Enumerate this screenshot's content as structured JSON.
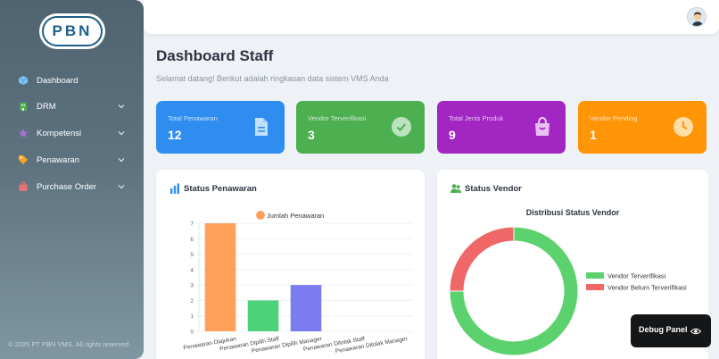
{
  "sidebar": {
    "logo": "PBN",
    "items": [
      {
        "label": "Dashboard",
        "icon": "cube-icon",
        "color": "#7cc4f0"
      },
      {
        "label": "DRM",
        "icon": "building-icon",
        "color": "#4caf50"
      },
      {
        "label": "Kompetensi",
        "icon": "star-icon",
        "color": "#b06bd6"
      },
      {
        "label": "Penawaran",
        "icon": "tag-icon",
        "color": "#f5a623"
      },
      {
        "label": "Purchase Order",
        "icon": "cart-icon",
        "color": "#e57373"
      }
    ],
    "copyright": "© 2025 PT PBN VMS. All rights reserved."
  },
  "header": {
    "title": "Dashboard Staff",
    "subtitle": "Selamat datang! Berikut adalah ringkasan data sistem VMS Anda"
  },
  "stats": [
    {
      "label": "Total Penawaran",
      "value": "12",
      "color": "#2f8df0",
      "icon": "document-icon"
    },
    {
      "label": "Vendor Terverifikasi",
      "value": "3",
      "color": "#4caf50",
      "icon": "check-circle-icon"
    },
    {
      "label": "Total Jenis Produk",
      "value": "9",
      "color": "#a126c2",
      "icon": "shopping-bag-icon"
    },
    {
      "label": "Vendor Pending",
      "value": "1",
      "color": "#ff9507",
      "icon": "clock-icon"
    }
  ],
  "panels": {
    "penawaran_title": "Status Penawaran",
    "vendor_title": "Status Vendor"
  },
  "debug": {
    "label": "Debug Panel"
  },
  "chart_data": [
    {
      "type": "bar",
      "legend": "Jumlah Penawaran",
      "categories": [
        "Penawaran Diajukan",
        "Penawaran Dipilih Staff",
        "Penawaran Dipilih Manager",
        "Penawaran Ditolak Staff",
        "Penawaran Ditolak Manager"
      ],
      "values": [
        7,
        2,
        3,
        0,
        0
      ],
      "colors": [
        "#ff9f5a",
        "#4cd37a",
        "#7b7cf2",
        "#ff6b6b",
        "#4fc3f7"
      ],
      "yticks": [
        "0",
        "1",
        "2",
        "3",
        "4",
        "5",
        "6",
        "7"
      ],
      "ylim": [
        0,
        7
      ]
    },
    {
      "type": "pie",
      "title": "Distribusi Status Vendor",
      "labels": [
        "Vendor Terverifikasi",
        "Vendor Belum Terverifikasi"
      ],
      "values": [
        3,
        1
      ],
      "colors": [
        "#5cd26e",
        "#ef6767"
      ]
    }
  ]
}
